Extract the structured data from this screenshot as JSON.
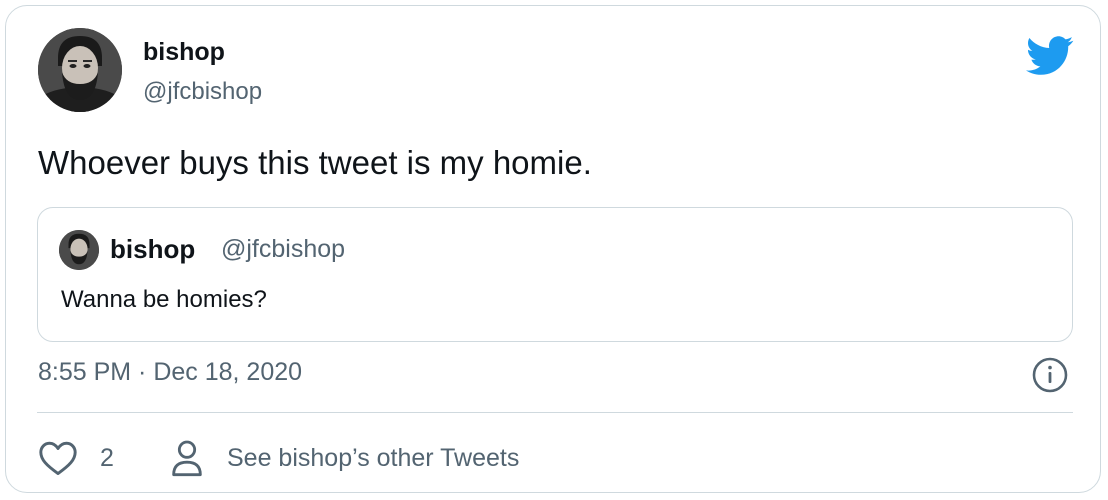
{
  "author": {
    "name": "bishop",
    "handle": "@jfcbishop"
  },
  "tweet": {
    "text": "Whoever buys this tweet is my homie."
  },
  "quoted_tweet": {
    "name": "bishop",
    "handle": "@jfcbishop",
    "text": "Wanna be homies?"
  },
  "meta": {
    "timestamp": "8:55 PM · Dec 18, 2020"
  },
  "actions": {
    "like_count": "2",
    "profile_link_label": "See bishop’s other Tweets"
  },
  "colors": {
    "brand": "#1d9bf0",
    "text_primary": "#0f1419",
    "text_secondary": "#536471",
    "border": "#cfd9de"
  },
  "icons": {
    "brand": "twitter-bird-icon",
    "info": "info-icon",
    "like": "heart-icon",
    "profile": "person-icon"
  }
}
